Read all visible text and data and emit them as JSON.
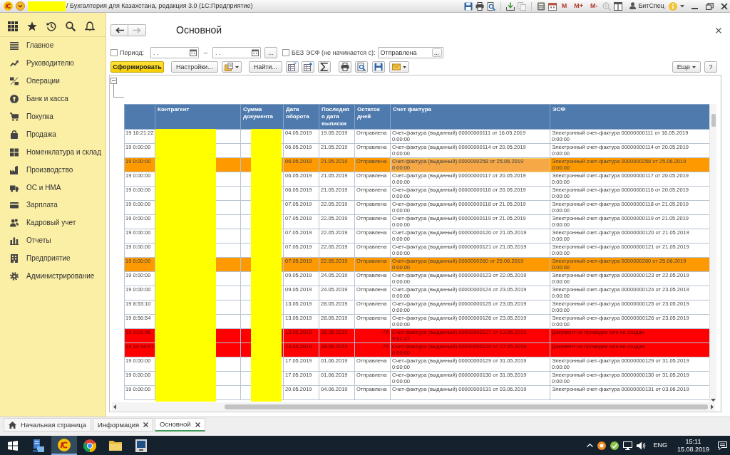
{
  "window": {
    "title": "/ Бухгалтерия для Казахстана, редакция 3.0 (1С:Предприятие)",
    "redacted_prefix": true,
    "memory_buttons": [
      "M",
      "M+",
      "M-"
    ],
    "user": "БитСпец"
  },
  "sidebar": {
    "items": [
      {
        "label": "Главное"
      },
      {
        "label": "Руководителю"
      },
      {
        "label": "Операции"
      },
      {
        "label": "Банк и касса"
      },
      {
        "label": "Покупка"
      },
      {
        "label": "Продажа"
      },
      {
        "label": "Номенклатура и склад"
      },
      {
        "label": "Производство"
      },
      {
        "label": "ОС и НМА"
      },
      {
        "label": "Зарплата"
      },
      {
        "label": "Кадровый учет"
      },
      {
        "label": "Отчеты"
      },
      {
        "label": "Предприятие"
      },
      {
        "label": "Администрирование"
      }
    ]
  },
  "form": {
    "title": "Основной",
    "navigation": [
      {
        "disabled": false
      },
      {
        "disabled": true
      }
    ],
    "filters": {
      "period": {
        "label": "Период:",
        "checked": false,
        "from": {
          "placeholder": ". ."
        },
        "separator": "–",
        "to": {
          "placeholder": ". ."
        },
        "select_button": "..."
      },
      "without_esf": {
        "label": "БЕЗ ЭСФ (не начинается с):",
        "checked": false,
        "value": "Отправлена",
        "select_button": "..."
      }
    },
    "toolbar": {
      "generate": "Сформировать",
      "settings": "Настройки...",
      "find": "Найти...",
      "more": "Еще",
      "help": "?"
    }
  },
  "report": {
    "columns": [
      {
        "label": "Контрагент",
        "redacted": true
      },
      {
        "label": "Сумма документа",
        "redacted": true
      },
      {
        "label": "Дата оборота",
        "redacted": false
      },
      {
        "label": "Последняя дата выписки",
        "redacted": false
      },
      {
        "label": "Остаток дней",
        "redacted": false
      },
      {
        "label": "Счет фактура",
        "redacted": false
      },
      {
        "label": "ЭСФ",
        "redacted": false
      }
    ],
    "rows": [
      {
        "column_1": "19 10:21:22",
        "turnover_date": "04.05.2019",
        "last_statement_date": "19.05.2019",
        "days_left": "Отправлена",
        "invoice": "Счет-фактура (выданный) 00000000111 от 16.05.2019 0:00:00",
        "esf": "Электронный счет-фактура 00000000111 от 16.05.2019 0:00:00",
        "kind": "sent",
        "color": "#ffffff",
        "selected": false
      },
      {
        "column_1": "19 0:00:00",
        "turnover_date": "06.05.2019",
        "last_statement_date": "21.05.2019",
        "days_left": "Отправлена",
        "invoice": "Счет-фактура (выданный) 00000000114 от 20.05.2019 0:00:00",
        "esf": "Электронный счет-фактура 00000000114 от 20.05.2019 0:00:00",
        "kind": "sent",
        "color": "#ffffff",
        "selected": false
      },
      {
        "column_1": "19 0:00:00",
        "turnover_date": "06.05.2019",
        "last_statement_date": "21.05.2019",
        "days_left": "Отправлена",
        "invoice": "Счет-фактура (выданный) 0000000258 от 25.06.2019 0:00:00",
        "esf": "Электронный счет-фактура 0000000258 от 25.06.2019 0:00:00",
        "kind": "sent",
        "color": "#ff9900",
        "selected": true
      },
      {
        "column_1": "19 0:00:00",
        "turnover_date": "06.05.2019",
        "last_statement_date": "21.05.2019",
        "days_left": "Отправлена",
        "invoice": "Счет-фактура (выданный) 00000000117 от 20.05.2019 0:00:00",
        "esf": "Электронный счет-фактура 00000000117 от 20.05.2019 0:00:00",
        "kind": "sent",
        "color": "#ffffff",
        "selected": false
      },
      {
        "column_1": "19 0:00:00",
        "turnover_date": "06.05.2019",
        "last_statement_date": "21.05.2019",
        "days_left": "Отправлена",
        "invoice": "Счет-фактура (выданный) 00000000116 от 20.05.2019 0:00:00",
        "esf": "Электронный счет-фактура 00000000116 от 20.05.2019 0:00:00",
        "kind": "sent",
        "color": "#ffffff",
        "selected": false
      },
      {
        "column_1": "19 0:00:00",
        "turnover_date": "07.05.2019",
        "last_statement_date": "22.05.2019",
        "days_left": "Отправлена",
        "invoice": "Счет-фактура (выданный) 00000000118 от 21.05.2019 0:00:00",
        "esf": "Электронный счет-фактура 00000000118 от 21.05.2019 0:00:00",
        "kind": "sent",
        "color": "#ffffff",
        "selected": false
      },
      {
        "column_1": "19 0:00:00",
        "turnover_date": "07.05.2019",
        "last_statement_date": "22.05.2019",
        "days_left": "Отправлена",
        "invoice": "Счет-фактура (выданный) 00000000119 от 21.05.2019 0:00:00",
        "esf": "Электронный счет-фактура 00000000119 от 21.05.2019 0:00:00",
        "kind": "sent",
        "color": "#ffffff",
        "selected": false
      },
      {
        "column_1": "19 0:00:00",
        "turnover_date": "07.05.2019",
        "last_statement_date": "22.05.2019",
        "days_left": "Отправлена",
        "invoice": "Счет-фактура (выданный) 00000000120 от 21.05.2019 0:00:00",
        "esf": "Электронный счет-фактура 00000000120 от 21.05.2019 0:00:00",
        "kind": "sent",
        "color": "#ffffff",
        "selected": false
      },
      {
        "column_1": "19 0:00:00",
        "turnover_date": "07.05.2019",
        "last_statement_date": "22.05.2019",
        "days_left": "Отправлена",
        "invoice": "Счет-фактура (выданный) 00000000121 от 21.05.2019 0:00:00",
        "esf": "Электронный счет-фактура 00000000121 от 21.05.2019 0:00:00",
        "kind": "sent",
        "color": "#ffffff",
        "selected": false
      },
      {
        "column_1": "19 0:00:00",
        "turnover_date": "07.05.2019",
        "last_statement_date": "22.05.2019",
        "days_left": "Отправлена",
        "invoice": "Счет-фактура (выданный) 0000000260 от 25.06.2019 0:00:00",
        "esf": "Электронный счет-фактура 0000000260 от 25.06.2019 0:00:00",
        "kind": "sent",
        "color": "#ff9900",
        "selected": false
      },
      {
        "column_1": "19 0:00:00",
        "turnover_date": "09.05.2019",
        "last_statement_date": "24.05.2019",
        "days_left": "Отправлена",
        "invoice": "Счет-фактура (выданный) 00000000123 от 22.05.2019 0:00:00",
        "esf": "Электронный счет-фактура 00000000123 от 22.05.2019 0:00:00",
        "kind": "sent",
        "color": "#ffffff",
        "selected": false
      },
      {
        "column_1": "19 0:00:00",
        "turnover_date": "09.05.2019",
        "last_statement_date": "24.05.2019",
        "days_left": "Отправлена",
        "invoice": "Счет-фактура (выданный) 00000000124 от 23.05.2019 0:00:00",
        "esf": "Электронный счет-фактура 00000000124 от 23.05.2019 0:00:00",
        "kind": "sent",
        "color": "#ffffff",
        "selected": false
      },
      {
        "column_1": "19 8:53:10",
        "turnover_date": "13.05.2019",
        "last_statement_date": "28.05.2019",
        "days_left": "Отправлена",
        "invoice": "Счет-фактура (выданный) 00000000125 от 23.05.2019 0:00:00",
        "esf": "Электронный счет-фактура 00000000125 от 23.05.2019 0:00:00",
        "kind": "sent",
        "color": "#ffffff",
        "selected": false
      },
      {
        "column_1": "19 8:56:54",
        "turnover_date": "13.05.2019",
        "last_statement_date": "28.05.2019",
        "days_left": "Отправлена",
        "invoice": "Счет-фактура (выданный) 00000000126 от 23.05.2019 0:00:00",
        "esf": "Электронный счет-фактура 00000000126 от 23.05.2019 0:00:00",
        "kind": "sent",
        "color": "#ffffff",
        "selected": false
      },
      {
        "column_1": "19 9:01:46",
        "turnover_date": "13.05.2019",
        "last_statement_date": "28.05.2019",
        "days_left": "-79",
        "invoice": "Счет-фактура (выданный) 00000000127 от 13.05.2019 9:01:47",
        "esf": "Документ не проведен или не создан",
        "kind": "error",
        "color": "#ff0000",
        "selected": false
      },
      {
        "column_1": "19 14:44:07",
        "turnover_date": "13.05.2019",
        "last_statement_date": "28.05.2019",
        "days_left": "-79",
        "invoice": "Счет-фактура (выданный) 00000000128 от 27.05.2019 0:00:00",
        "esf": "Документ не проведен или не создан",
        "kind": "error",
        "color": "#ff0000",
        "selected": false
      },
      {
        "column_1": "19 0:00:00",
        "turnover_date": "17.05.2019",
        "last_statement_date": "01.06.2019",
        "days_left": "Отправлена",
        "invoice": "Счет-фактура (выданный) 00000000129 от 31.05.2019 0:00:00",
        "esf": "Электронный счет-фактура 00000000129 от 31.05.2019 0:00:00",
        "kind": "sent",
        "color": "#ffffff",
        "selected": false
      },
      {
        "column_1": "19 0:00:00",
        "turnover_date": "17.05.2019",
        "last_statement_date": "01.06.2019",
        "days_left": "Отправлена",
        "invoice": "Счет-фактура (выданный) 00000000130 от 31.05.2019 0:00:00",
        "esf": "Электронный счет-фактура 00000000130 от 31.05.2019 0:00:00",
        "kind": "sent",
        "color": "#ffffff",
        "selected": false
      },
      {
        "column_1": "19 0:00:00",
        "turnover_date": "20.05.2019",
        "last_statement_date": "04.06.2019",
        "days_left": "Отправлена",
        "invoice": "Счет-фактура (выданный) 00000000131 от 03.06.2019",
        "esf": "Электронный счет-фактура 00000000131 от 03.06.2019",
        "kind": "sent",
        "color": "#ffffff",
        "selected": false
      }
    ]
  },
  "tabs": [
    {
      "label": "Начальная страница",
      "kind": "home",
      "selected": false
    },
    {
      "label": "Информация",
      "kind": "closable",
      "selected": false
    },
    {
      "label": "Основной",
      "kind": "closable",
      "selected": true
    }
  ],
  "taskbar": {
    "apps": [
      {
        "selected": false
      },
      {
        "selected": true
      },
      {
        "selected": false
      },
      {
        "selected": false
      },
      {
        "selected": false
      }
    ],
    "language": "ENG",
    "time": "15:11",
    "date": "15.08.2019"
  }
}
